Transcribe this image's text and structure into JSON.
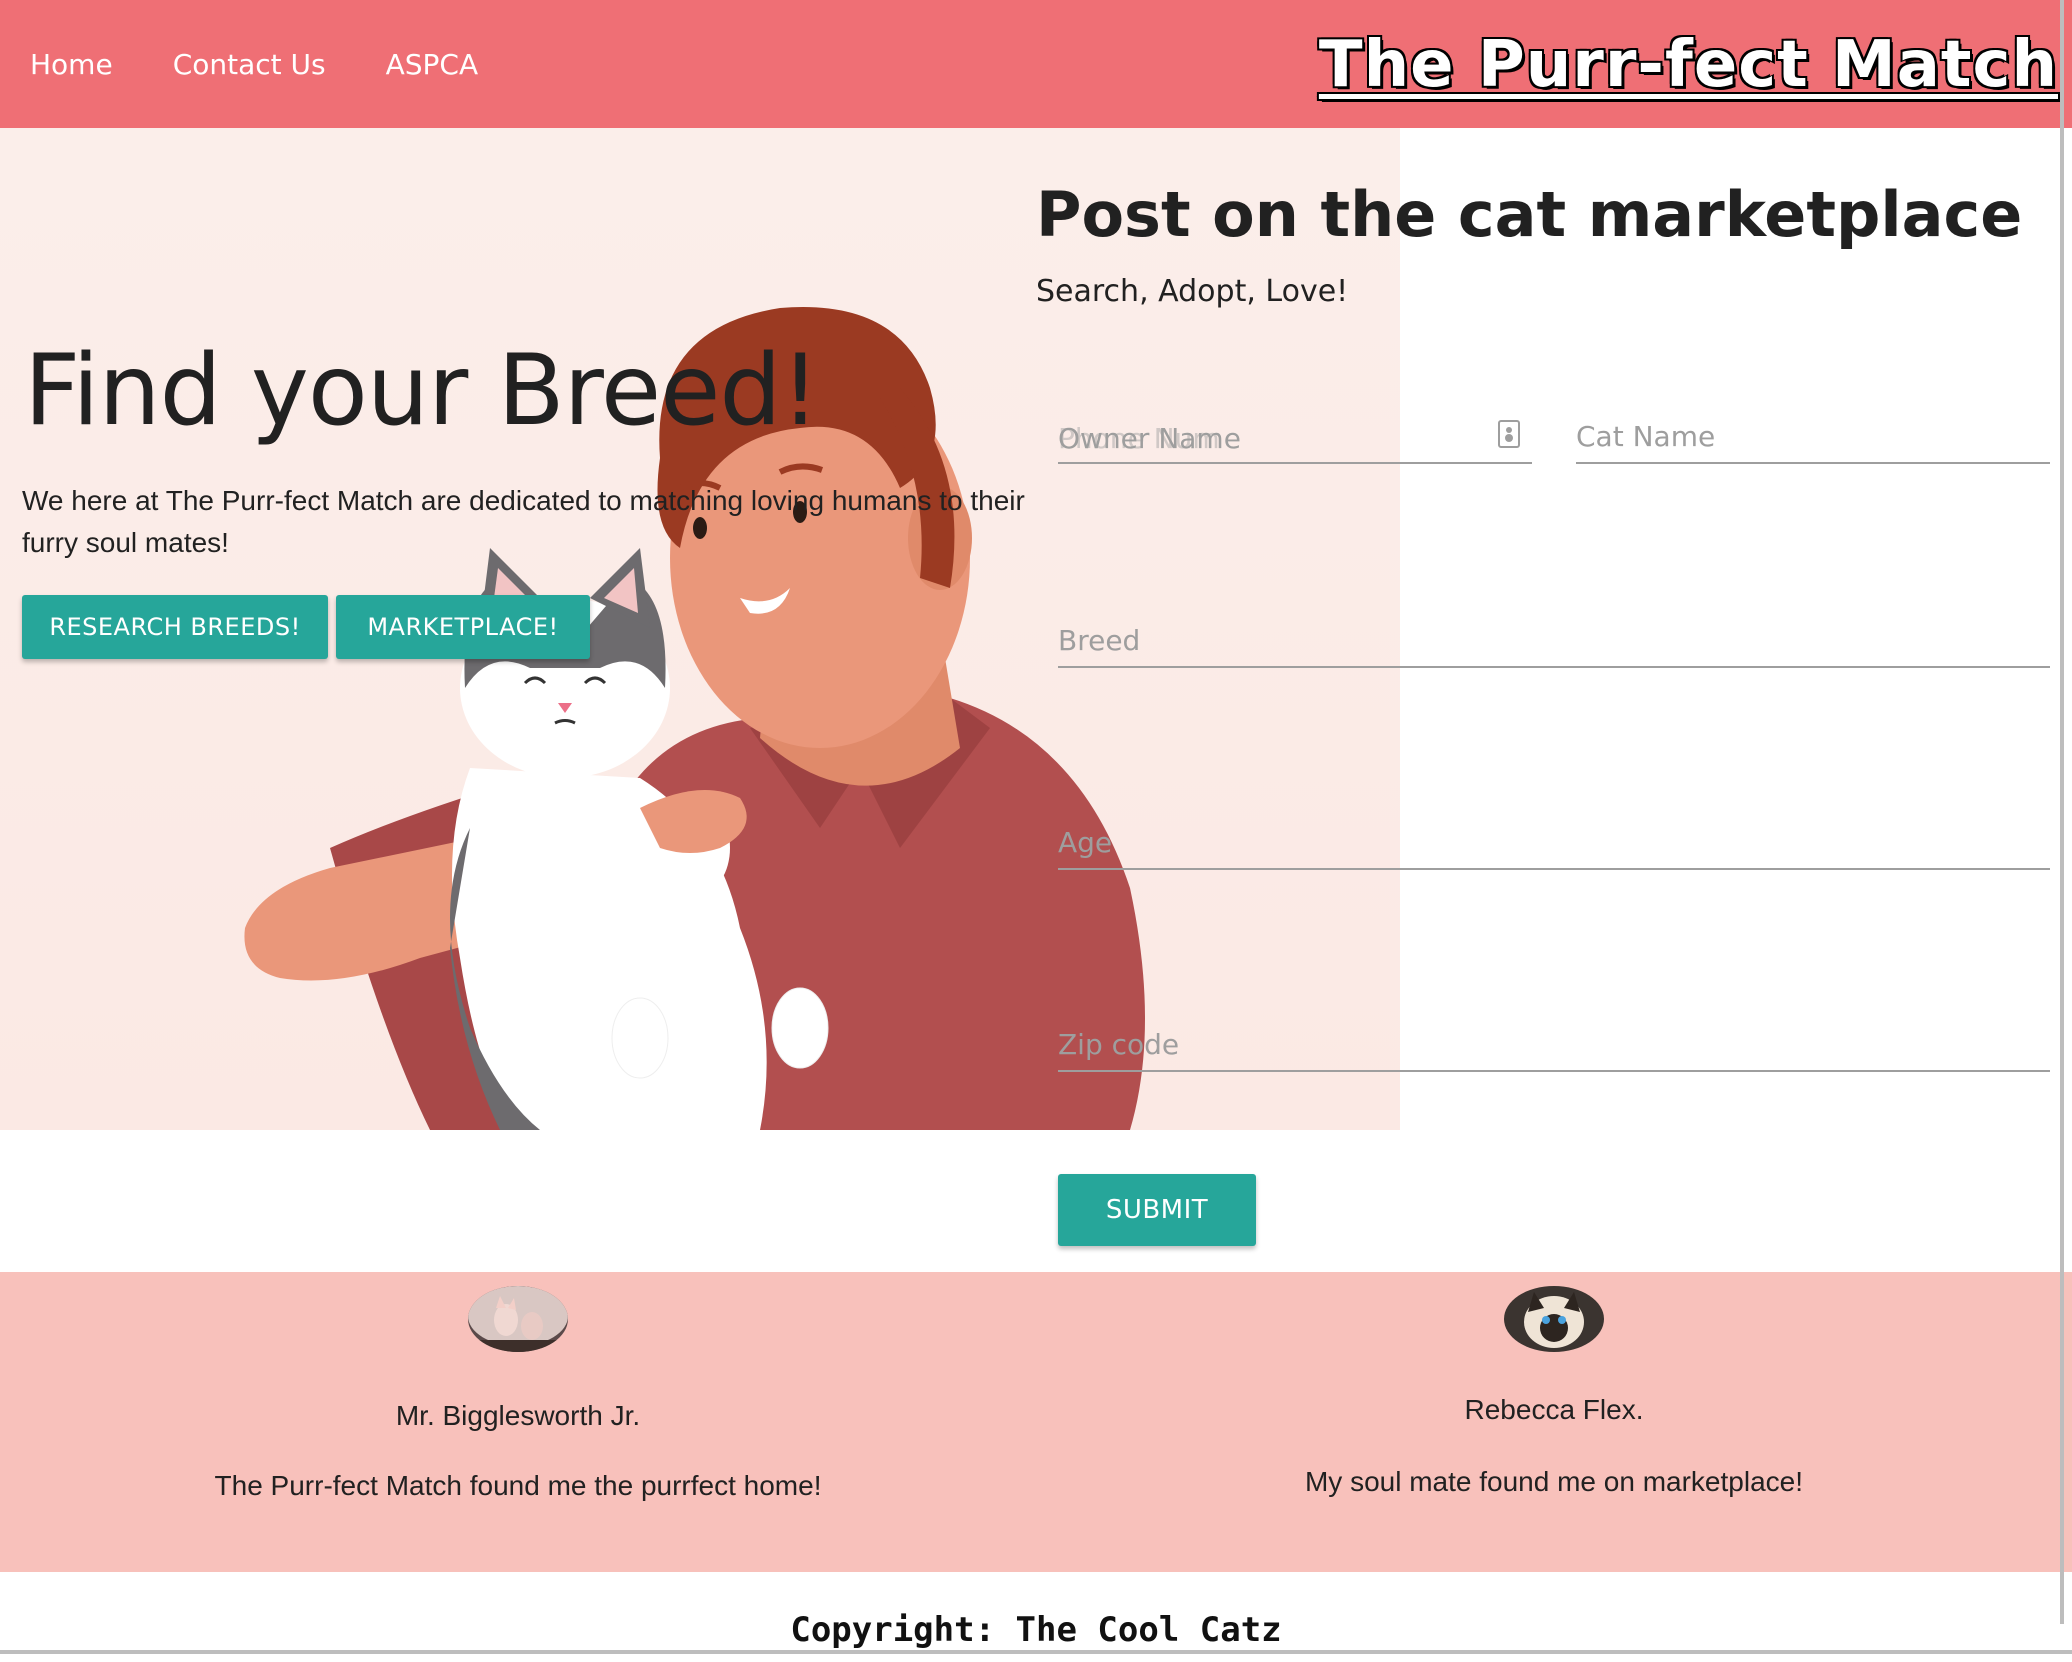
{
  "nav": {
    "links": [
      "Home",
      "Contact Us",
      "ASPCA"
    ],
    "brand": "The Purr-fect Match"
  },
  "hero": {
    "title": "Find your Breed!",
    "text": "We here at The Purr-fect Match are dedicated to matching loving humans to their furry soul mates!",
    "buttons": [
      "RESEARCH BREEDS!",
      "MARKETPLACE!"
    ]
  },
  "form": {
    "title": "Post on the cat marketplace",
    "subtitle": "Search, Adopt, Love!",
    "fields": {
      "owner_name": "Owner Name",
      "phone": "Phone Num",
      "cat_name": "Cat Name",
      "breed": "Breed",
      "age": "Age",
      "zip": "Zip code"
    },
    "submit": "SUBMIT"
  },
  "testimonials": [
    {
      "name": "Mr. Bigglesworth Jr.",
      "quote": "The Purr-fect Match found me the purrfect home!"
    },
    {
      "name": "Rebecca Flex.",
      "quote": "My soul mate found me on marketplace!"
    }
  ],
  "footer": {
    "copyright": "Copyright: The Cool Catz"
  },
  "colors": {
    "navbar": "#ef6f75",
    "accent": "#26a69a",
    "testimonial_bg": "#f8c1bb",
    "hero_bg": "#fbeeea"
  }
}
